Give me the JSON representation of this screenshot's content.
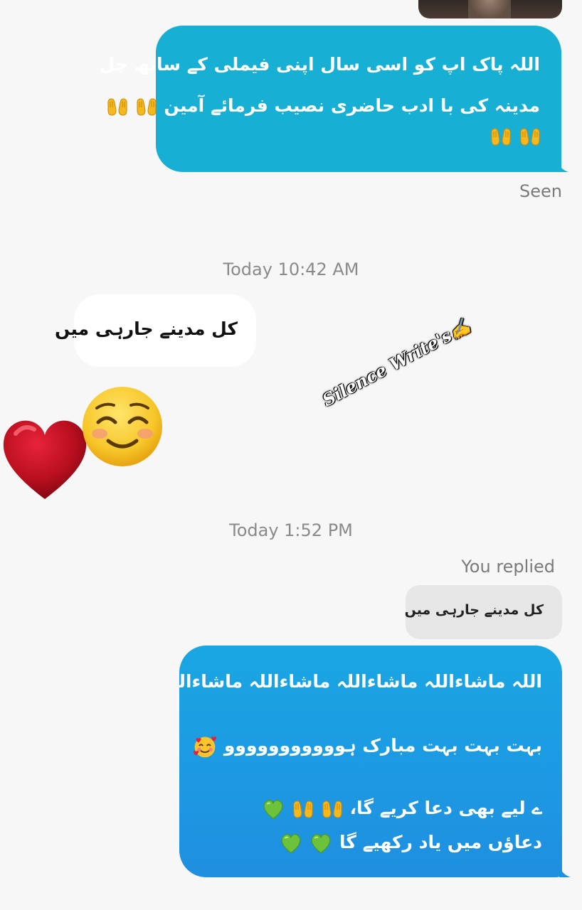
{
  "messages": {
    "outgoing_1": {
      "line1": "اللہ پاک اپ کو اسی سال اپنی فیملی کے ساتھ چل",
      "line2": "مدینہ کی با ادب حاضری نصیب فرمائے آمین"
    },
    "seen_label": "Seen",
    "timestamp_1": "Today 10:42 AM",
    "incoming_1": "کل مدینے جارہی میں",
    "watermark": "Silence Write's✍",
    "timestamp_2": "Today 1:52 PM",
    "you_replied_label": "You replied",
    "reply_quote": "کل مدینے جارہی میں",
    "outgoing_2": {
      "line1": "اللہ ماشاءاللہ ماشاءاللہ ماشاءاللہ ماشاءاللہ",
      "line2": "بہت بہت بہت مبارک ہووووووووووو",
      "line3": "ے لیے بھی دعا کریے گا،",
      "line4": "دعاؤں میں یاد رکھیے گا"
    }
  },
  "icons": {
    "reaction_heart": "red-heart-icon",
    "reaction_smile": "smiling-face-icon",
    "praying_hands": "open-hands-icon",
    "smiling_hearts": "smiling-face-with-hearts-icon",
    "green_heart": "green-heart-icon"
  },
  "colors": {
    "cyan_bubble": "#17b0d4",
    "blue_bubble": "#1f8fe0",
    "background": "#f7f7f7"
  }
}
